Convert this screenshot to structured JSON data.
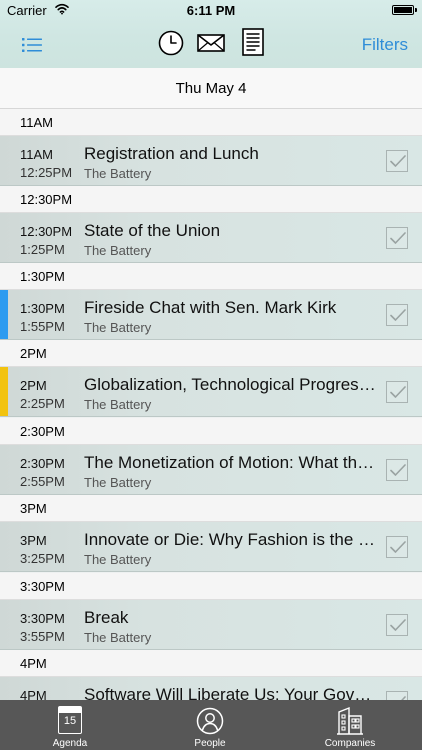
{
  "status": {
    "carrier": "Carrier",
    "time": "6:11 PM"
  },
  "nav": {
    "filters_label": "Filters",
    "icons": [
      "list-icon",
      "clock-icon",
      "mail-icon",
      "document-icon"
    ]
  },
  "date_header": "Thu May 4",
  "schedule": [
    {
      "section_label": "11AM",
      "start": "11AM",
      "end": "12:25PM",
      "title": "Registration and Lunch",
      "location": "The Battery",
      "accent": null,
      "checked": true
    },
    {
      "section_label": "12:30PM",
      "start": "12:30PM",
      "end": "1:25PM",
      "title": "State of the Union",
      "location": "The Battery",
      "accent": null,
      "checked": true
    },
    {
      "section_label": "1:30PM",
      "start": "1:30PM",
      "end": "1:55PM",
      "title": "Fireside Chat with Sen. Mark Kirk",
      "location": "The Battery",
      "accent": "#2d9bf0",
      "checked": true
    },
    {
      "section_label": "2PM",
      "start": "2PM",
      "end": "2:25PM",
      "title": "Globalization, Technological Progress and Job Creation",
      "location": "The Battery",
      "accent": "#f2c30f",
      "checked": true
    },
    {
      "section_label": "2:30PM",
      "start": "2:30PM",
      "end": "2:55PM",
      "title": "The Monetization of Motion: What the Future Holds",
      "location": "The Battery",
      "accent": null,
      "checked": true
    },
    {
      "section_label": "3PM",
      "start": "3PM",
      "end": "3:25PM",
      "title": "Innovate or Die: Why Fashion is the Next Frontier",
      "location": "The Battery",
      "accent": null,
      "checked": true
    },
    {
      "section_label": "3:30PM",
      "start": "3:30PM",
      "end": "3:55PM",
      "title": "Break",
      "location": "The Battery",
      "accent": null,
      "checked": true
    },
    {
      "section_label": "4PM",
      "start": "4PM",
      "end": "",
      "title": "Software Will Liberate Us: Your Government",
      "location": "",
      "accent": null,
      "checked": true
    }
  ],
  "tabbar": {
    "agenda_label": "Agenda",
    "agenda_day": "15",
    "people_label": "People",
    "companies_label": "Companies"
  },
  "colors": {
    "link_blue": "#2f8dd8",
    "tabbar_bg": "#575757"
  }
}
